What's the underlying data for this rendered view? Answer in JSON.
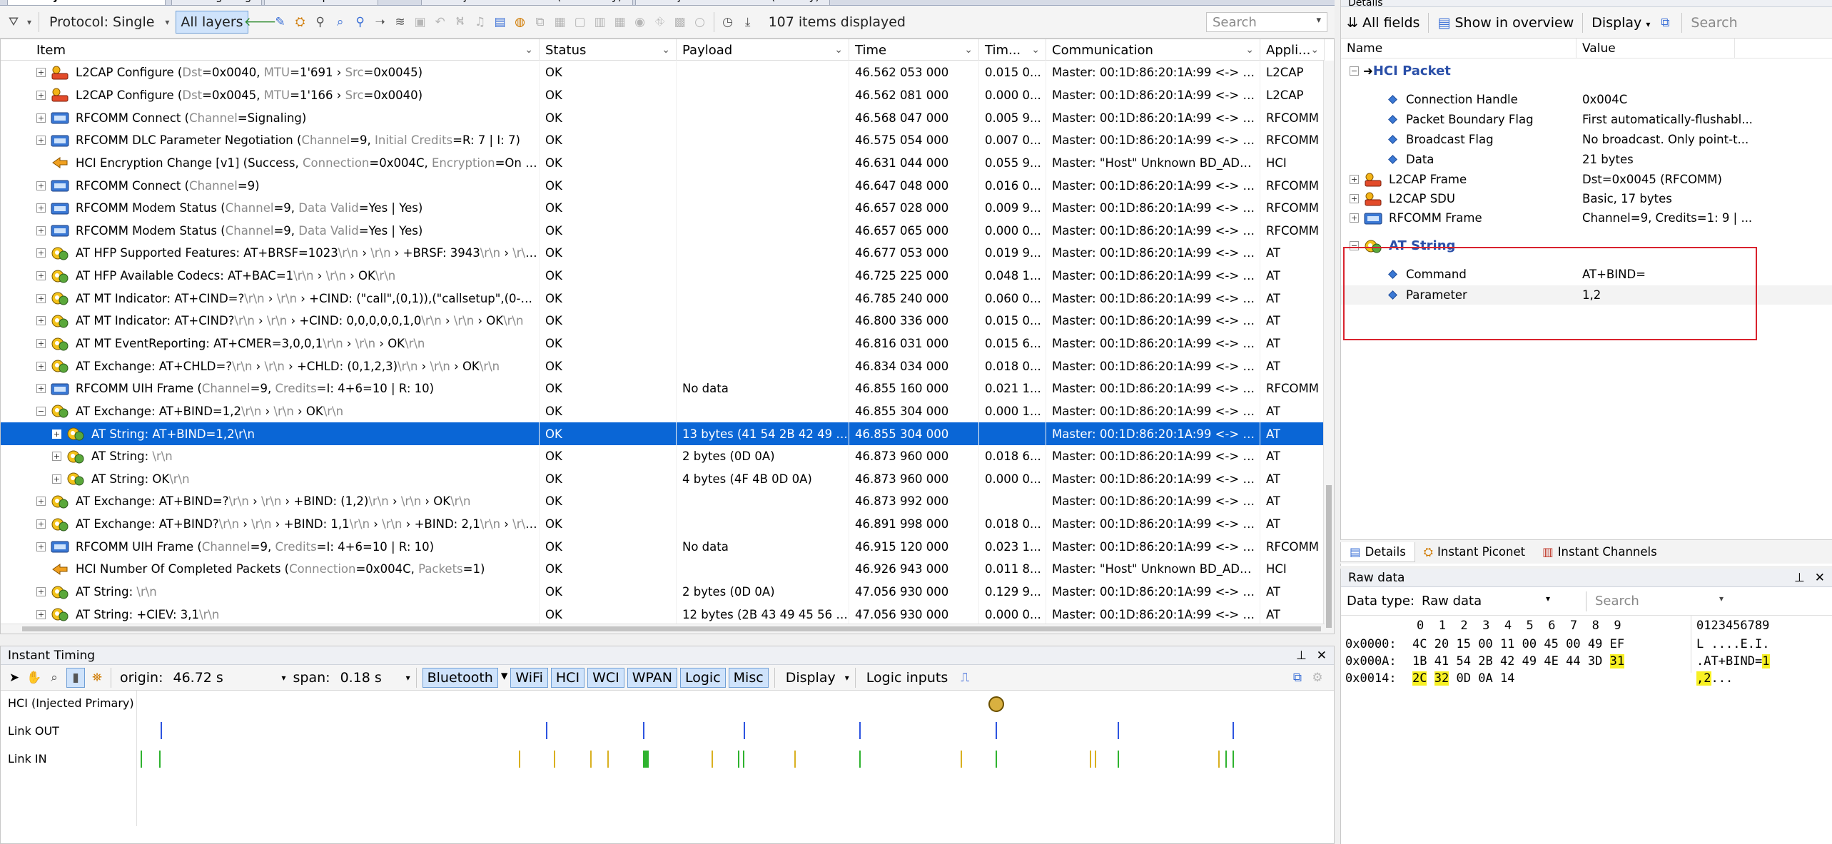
{
  "tabs": [
    "HCI Injection Overview",
    "Message Log",
    "Instant Spectrum",
    "HCI Injection Overview (Secondary)",
    "HCI Injection Overview (Tertiary)"
  ],
  "toolbar": {
    "protocol_label": "Protocol: Single",
    "all_layers_label": "All layers",
    "items_count": "107 items displayed",
    "search_placeholder": "Search"
  },
  "table": {
    "columns": [
      "Item",
      "Status",
      "Payload",
      "Time",
      "Tim...",
      "Communication",
      "Appli..."
    ],
    "rows": [
      {
        "level": 0,
        "exp": "+",
        "icon": "l2cap",
        "text": "L2CAP Configure (",
        "parts": [
          [
            "Dst",
            true
          ],
          [
            "=0x0040, ",
            false
          ],
          [
            "MTU",
            true
          ],
          [
            "=1'691 › ",
            false
          ],
          [
            "Src",
            true
          ],
          [
            "=0x0045)",
            false
          ]
        ],
        "status": "OK",
        "payload": "",
        "time": "46.562 053 000",
        "delta": "0.015 0...",
        "comm": "Master: 00:1D:86:20:1A:99 <-> Sla...",
        "app": "L2CAP",
        "selected": false
      },
      {
        "level": 0,
        "exp": "+",
        "icon": "l2cap",
        "text": "L2CAP Configure (",
        "parts": [
          [
            "Dst",
            true
          ],
          [
            "=0x0045, ",
            false
          ],
          [
            "MTU",
            true
          ],
          [
            "=1'166 › ",
            false
          ],
          [
            "Src",
            true
          ],
          [
            "=0x0040)",
            false
          ]
        ],
        "status": "OK",
        "payload": "",
        "time": "46.562 081 000",
        "delta": "0.000 0...",
        "comm": "Master: 00:1D:86:20:1A:99 <-> Sla...",
        "app": "L2CAP",
        "selected": false
      },
      {
        "level": 0,
        "exp": "+",
        "icon": "rfcomm",
        "text": "RFCOMM Connect (",
        "parts": [
          [
            "Channel",
            true
          ],
          [
            "=Signaling)",
            false
          ]
        ],
        "status": "OK",
        "payload": "",
        "time": "46.568 047 000",
        "delta": "0.005 9...",
        "comm": "Master: 00:1D:86:20:1A:99 <-> Sla...",
        "app": "RFCOMM",
        "selected": false
      },
      {
        "level": 0,
        "exp": "+",
        "icon": "rfcomm",
        "text": "RFCOMM DLC Parameter Negotiation (",
        "parts": [
          [
            "Channel",
            true
          ],
          [
            "=9, ",
            false
          ],
          [
            "Initial Credits",
            true
          ],
          [
            "=R: 7 | I: 7)",
            false
          ]
        ],
        "status": "OK",
        "payload": "",
        "time": "46.575 054 000",
        "delta": "0.007 0...",
        "comm": "Master: 00:1D:86:20:1A:99 <-> Sla...",
        "app": "RFCOMM",
        "selected": false
      },
      {
        "level": 0,
        "exp": "",
        "icon": "arrow",
        "text": "HCI Encryption Change [v1] (Success, ",
        "parts": [
          [
            "Connection",
            true
          ],
          [
            "=0x004C, ",
            false
          ],
          [
            "Encryption",
            true
          ],
          [
            "=On (BR/EDR ...",
            false
          ]
        ],
        "status": "OK",
        "payload": "",
        "time": "46.631 044 000",
        "delta": "0.055 9...",
        "comm": "Master: \"Host\" Unknown BD_ADDR ...",
        "app": "HCI",
        "selected": false
      },
      {
        "level": 0,
        "exp": "+",
        "icon": "rfcomm",
        "text": "RFCOMM Connect (",
        "parts": [
          [
            "Channel",
            true
          ],
          [
            "=9)",
            false
          ]
        ],
        "status": "OK",
        "payload": "",
        "time": "46.647 048 000",
        "delta": "0.016 0...",
        "comm": "Master: 00:1D:86:20:1A:99 <-> Sla...",
        "app": "RFCOMM",
        "selected": false
      },
      {
        "level": 0,
        "exp": "+",
        "icon": "rfcomm",
        "text": "RFCOMM Modem Status (",
        "parts": [
          [
            "Channel",
            true
          ],
          [
            "=9, ",
            false
          ],
          [
            "Data Valid",
            true
          ],
          [
            "=Yes | Yes)",
            false
          ]
        ],
        "status": "OK",
        "payload": "",
        "time": "46.657 028 000",
        "delta": "0.009 9...",
        "comm": "Master: 00:1D:86:20:1A:99 <-> Sla...",
        "app": "RFCOMM",
        "selected": false
      },
      {
        "level": 0,
        "exp": "+",
        "icon": "rfcomm",
        "text": "RFCOMM Modem Status (",
        "parts": [
          [
            "Channel",
            true
          ],
          [
            "=9, ",
            false
          ],
          [
            "Data Valid",
            true
          ],
          [
            "=Yes | Yes)",
            false
          ]
        ],
        "status": "OK",
        "payload": "",
        "time": "46.657 065 000",
        "delta": "0.000 0...",
        "comm": "Master: 00:1D:86:20:1A:99 <-> Sla...",
        "app": "RFCOMM",
        "selected": false
      },
      {
        "level": 0,
        "exp": "+",
        "icon": "at",
        "text": "AT HFP Supported Features: AT+BRSF=1023",
        "parts": [
          [
            "\\r\\n",
            true
          ],
          [
            " › ",
            false
          ],
          [
            "\\r\\n",
            true
          ],
          [
            " › +BRSF: 3943",
            false
          ],
          [
            "\\r\\n",
            true
          ],
          [
            " › ",
            false
          ],
          [
            "\\r\\n",
            true
          ],
          [
            " › OK",
            false
          ],
          [
            "\\r\\...",
            true
          ]
        ],
        "status": "OK",
        "payload": "",
        "time": "46.677 053 000",
        "delta": "0.019 9...",
        "comm": "Master: 00:1D:86:20:1A:99 <-> Sla...",
        "app": "AT",
        "selected": false
      },
      {
        "level": 0,
        "exp": "+",
        "icon": "at",
        "text": "AT HFP Available Codecs: AT+BAC=1",
        "parts": [
          [
            "\\r\\n",
            true
          ],
          [
            " › ",
            false
          ],
          [
            "\\r\\n",
            true
          ],
          [
            " › OK",
            false
          ],
          [
            "\\r\\n",
            true
          ]
        ],
        "status": "OK",
        "payload": "",
        "time": "46.725 225 000",
        "delta": "0.048 1...",
        "comm": "Master: 00:1D:86:20:1A:99 <-> Sla...",
        "app": "AT",
        "selected": false
      },
      {
        "level": 0,
        "exp": "+",
        "icon": "at",
        "text": "AT MT Indicator: AT+CIND=?",
        "parts": [
          [
            "\\r\\n",
            true
          ],
          [
            " › ",
            false
          ],
          [
            "\\r\\n",
            true
          ],
          [
            " › +CIND: (\"call\",(0,1)),(\"callsetup\",(0-3)),(\"ser...",
            false
          ]
        ],
        "status": "OK",
        "payload": "",
        "time": "46.785 240 000",
        "delta": "0.060 0...",
        "comm": "Master: 00:1D:86:20:1A:99 <-> Sla...",
        "app": "AT",
        "selected": false
      },
      {
        "level": 0,
        "exp": "+",
        "icon": "at",
        "text": "AT MT Indicator: AT+CIND?",
        "parts": [
          [
            "\\r\\n",
            true
          ],
          [
            " › ",
            false
          ],
          [
            "\\r\\n",
            true
          ],
          [
            " › +CIND: 0,0,0,0,0,1,0",
            false
          ],
          [
            "\\r\\n",
            true
          ],
          [
            " › ",
            false
          ],
          [
            "\\r\\n",
            true
          ],
          [
            " › OK",
            false
          ],
          [
            "\\r\\n",
            true
          ]
        ],
        "status": "OK",
        "payload": "",
        "time": "46.800 336 000",
        "delta": "0.015 0...",
        "comm": "Master: 00:1D:86:20:1A:99 <-> Sla...",
        "app": "AT",
        "selected": false
      },
      {
        "level": 0,
        "exp": "+",
        "icon": "at",
        "text": "AT MT EventReporting: AT+CMER=3,0,0,1",
        "parts": [
          [
            "\\r\\n",
            true
          ],
          [
            " › ",
            false
          ],
          [
            "\\r\\n",
            true
          ],
          [
            " › OK",
            false
          ],
          [
            "\\r\\n",
            true
          ]
        ],
        "status": "OK",
        "payload": "",
        "time": "46.816 031 000",
        "delta": "0.015 6...",
        "comm": "Master: 00:1D:86:20:1A:99 <-> Sla...",
        "app": "AT",
        "selected": false
      },
      {
        "level": 0,
        "exp": "+",
        "icon": "at",
        "text": "AT Exchange: AT+CHLD=?",
        "parts": [
          [
            "\\r\\n",
            true
          ],
          [
            " › ",
            false
          ],
          [
            "\\r\\n",
            true
          ],
          [
            " › +CHLD: (0,1,2,3)",
            false
          ],
          [
            "\\r\\n",
            true
          ],
          [
            " › ",
            false
          ],
          [
            "\\r\\n",
            true
          ],
          [
            " › OK",
            false
          ],
          [
            "\\r\\n",
            true
          ]
        ],
        "status": "OK",
        "payload": "",
        "time": "46.834 034 000",
        "delta": "0.018 0...",
        "comm": "Master: 00:1D:86:20:1A:99 <-> Sla...",
        "app": "AT",
        "selected": false
      },
      {
        "level": 0,
        "exp": "+",
        "icon": "rfcomm",
        "text": "RFCOMM UIH Frame (",
        "parts": [
          [
            "Channel",
            true
          ],
          [
            "=9, ",
            false
          ],
          [
            "Credits",
            true
          ],
          [
            "=I: 4+6=10 | R: 10)",
            false
          ]
        ],
        "status": "OK",
        "payload": "No data",
        "time": "46.855 160 000",
        "delta": "0.021 1...",
        "comm": "Master: 00:1D:86:20:1A:99 <-> Sla...",
        "app": "RFCOMM",
        "selected": false
      },
      {
        "level": 0,
        "exp": "−",
        "icon": "at",
        "text": "AT Exchange: AT+BIND=1,2",
        "parts": [
          [
            "\\r\\n",
            true
          ],
          [
            " › ",
            false
          ],
          [
            "\\r\\n",
            true
          ],
          [
            " › OK",
            false
          ],
          [
            "\\r\\n",
            true
          ]
        ],
        "status": "OK",
        "payload": "",
        "time": "46.855 304 000",
        "delta": "0.000 1...",
        "comm": "Master: 00:1D:86:20:1A:99 <-> Sla...",
        "app": "AT",
        "selected": false
      },
      {
        "level": 1,
        "exp": "+",
        "icon": "at",
        "text": "AT String: AT+BIND=1,2\\r\\n",
        "parts": [],
        "status": "OK",
        "payload": "13 bytes (41 54 2B 42 49 4E...",
        "time": "46.855 304 000",
        "delta": "",
        "comm": "Master: 00:1D:86:20:1A:99 <-> Sla...",
        "app": "AT",
        "selected": true
      },
      {
        "level": 1,
        "exp": "+",
        "icon": "at",
        "text": "AT String: ",
        "parts": [
          [
            "\\r\\n",
            true
          ]
        ],
        "status": "OK",
        "payload": "2 bytes (0D 0A)",
        "time": "46.873 960 000",
        "delta": "0.018 6...",
        "comm": "Master: 00:1D:86:20:1A:99 <-> Sla...",
        "app": "AT",
        "selected": false
      },
      {
        "level": 1,
        "exp": "+",
        "icon": "at",
        "text": "AT String: OK",
        "parts": [
          [
            "\\r\\n",
            true
          ]
        ],
        "status": "OK",
        "payload": "4 bytes (4F 4B 0D 0A)",
        "time": "46.873 960 000",
        "delta": "0.000 0...",
        "comm": "Master: 00:1D:86:20:1A:99 <-> Sla...",
        "app": "AT",
        "selected": false
      },
      {
        "level": 0,
        "exp": "+",
        "icon": "at",
        "text": "AT Exchange: AT+BIND=?",
        "parts": [
          [
            "\\r\\n",
            true
          ],
          [
            " › ",
            false
          ],
          [
            "\\r\\n",
            true
          ],
          [
            " › +BIND: (1,2)",
            false
          ],
          [
            "\\r\\n",
            true
          ],
          [
            " › ",
            false
          ],
          [
            "\\r\\n",
            true
          ],
          [
            " › OK",
            false
          ],
          [
            "\\r\\n",
            true
          ]
        ],
        "status": "OK",
        "payload": "",
        "time": "46.873 992 000",
        "delta": "",
        "comm": "Master: 00:1D:86:20:1A:99 <-> Sla...",
        "app": "AT",
        "selected": false
      },
      {
        "level": 0,
        "exp": "+",
        "icon": "at",
        "text": "AT Exchange: AT+BIND?",
        "parts": [
          [
            "\\r\\n",
            true
          ],
          [
            " › ",
            false
          ],
          [
            "\\r\\n",
            true
          ],
          [
            " › +BIND: 1,1",
            false
          ],
          [
            "\\r\\n",
            true
          ],
          [
            " › ",
            false
          ],
          [
            "\\r\\n",
            true
          ],
          [
            " › +BIND: 2,1",
            false
          ],
          [
            "\\r\\n",
            true
          ],
          [
            " › ",
            false
          ],
          [
            "\\r\\n",
            true
          ],
          [
            " › OK",
            false
          ]
        ],
        "status": "OK",
        "payload": "",
        "time": "46.891 998 000",
        "delta": "0.018 0...",
        "comm": "Master: 00:1D:86:20:1A:99 <-> Sla...",
        "app": "AT",
        "selected": false
      },
      {
        "level": 0,
        "exp": "+",
        "icon": "rfcomm",
        "text": "RFCOMM UIH Frame (",
        "parts": [
          [
            "Channel",
            true
          ],
          [
            "=9, ",
            false
          ],
          [
            "Credits",
            true
          ],
          [
            "=I: 4+6=10 | R: 10)",
            false
          ]
        ],
        "status": "OK",
        "payload": "No data",
        "time": "46.915 120 000",
        "delta": "0.023 1...",
        "comm": "Master: 00:1D:86:20:1A:99 <-> Sla...",
        "app": "RFCOMM",
        "selected": false
      },
      {
        "level": 0,
        "exp": "",
        "icon": "arrow",
        "text": "HCI Number Of Completed Packets (",
        "parts": [
          [
            "Connection",
            true
          ],
          [
            "=0x004C, ",
            false
          ],
          [
            "Packets",
            true
          ],
          [
            "=1)",
            false
          ]
        ],
        "status": "OK",
        "payload": "",
        "time": "46.926 943 000",
        "delta": "0.011 8...",
        "comm": "Master: \"Host\" Unknown BD_ADDR ...",
        "app": "HCI",
        "selected": false
      },
      {
        "level": 0,
        "exp": "+",
        "icon": "at",
        "text": "AT String: ",
        "parts": [
          [
            "\\r\\n",
            true
          ]
        ],
        "status": "OK",
        "payload": "2 bytes (0D 0A)",
        "time": "47.056 930 000",
        "delta": "0.129 9...",
        "comm": "Master: 00:1D:86:20:1A:99 <-> Sla...",
        "app": "AT",
        "selected": false
      },
      {
        "level": 0,
        "exp": "+",
        "icon": "at",
        "text": "AT String: +CIEV: 3,1",
        "parts": [
          [
            "\\r\\n",
            true
          ]
        ],
        "status": "OK",
        "payload": "12 bytes (2B 43 49 45 56 3A...",
        "time": "47.056 930 000",
        "delta": "0.000 0...",
        "comm": "Master: 00:1D:86:20:1A:99 <-> Sla...",
        "app": "AT",
        "selected": false
      }
    ]
  },
  "timing": {
    "title": "Instant Timing",
    "origin_label": "origin:",
    "origin_value": "46.72 s",
    "span_label": "span:",
    "span_value": "0.18 s",
    "buttons": [
      "Bluetooth",
      "WiFi",
      "HCI",
      "WCI",
      "WPAN",
      "Logic",
      "Misc"
    ],
    "display_label": "Display",
    "logic_inputs_label": "Logic inputs",
    "tracks": [
      "HCI (Injected Primary)",
      "Link OUT",
      "Link IN"
    ]
  },
  "details": {
    "title": "Details",
    "all_fields_label": "All fields",
    "show_overview_label": "Show in overview",
    "display_label": "Display",
    "search_placeholder": "Search",
    "col_name": "Name",
    "col_value": "Value",
    "section_hci": "HCI Packet",
    "fields": [
      {
        "name": "Connection Handle",
        "value": "0x004C"
      },
      {
        "name": "Packet Boundary Flag",
        "value": "First automatically-flushabl..."
      },
      {
        "name": "Broadcast Flag",
        "value": "No broadcast. Only point-t..."
      },
      {
        "name": "Data",
        "value": "21 bytes"
      }
    ],
    "frames": [
      {
        "name": "L2CAP Frame",
        "value": "Dst=0x0045 (RFCOMM)"
      },
      {
        "name": "L2CAP SDU",
        "value": "Basic, 17 bytes"
      },
      {
        "name": "RFCOMM Frame",
        "value": "Channel=9, Credits=1: 9 | ..."
      }
    ],
    "section_at": "AT String",
    "at_fields": [
      {
        "name": "Command",
        "value": "AT+BIND="
      },
      {
        "name": "Parameter",
        "value": "1,2"
      }
    ],
    "bottom_tabs": [
      "Details",
      "Instant Piconet",
      "Instant Channels"
    ]
  },
  "raw": {
    "title": "Raw data",
    "type_label": "Data type:",
    "type_value": "Raw data",
    "search_placeholder": "Search",
    "col_header": "0  1  2  3  4  5  6  7  8  9",
    "ascii_header": "0123456789",
    "rows": [
      {
        "addr": "0x0000:",
        "bytes": "4C 20 15 00 11 00 45 00 49 EF",
        "ascii": "L ....E.I."
      },
      {
        "addr": "0x000A:",
        "bytes": "1B 41 54 2B 42 49 4E 44 3D 31",
        "ascii": ".AT+BIND=1"
      },
      {
        "addr": "0x0014:",
        "bytes": "2C 32 0D 0A 14",
        "ascii": ",2..."
      }
    ]
  },
  "colors": {
    "accent": "#0a66d6",
    "highlight": "#f7f024",
    "redbox": "#d9232e",
    "section": "#2a4fa8"
  }
}
